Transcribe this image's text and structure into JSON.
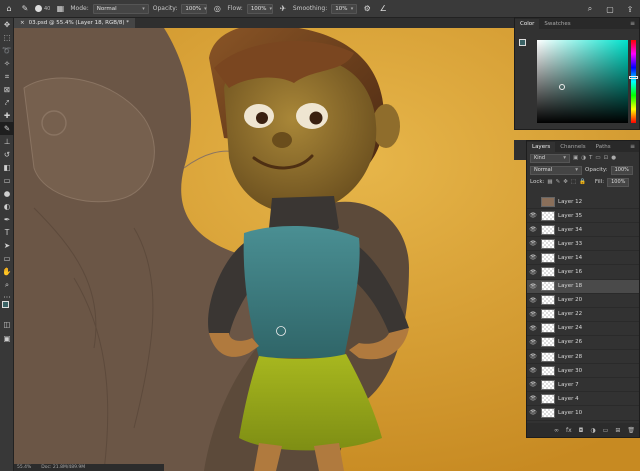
{
  "options_bar": {
    "brush_size": "40",
    "mode_label": "Mode:",
    "mode_value": "Normal",
    "opacity_label": "Opacity:",
    "opacity_value": "100%",
    "flow_label": "Flow:",
    "flow_value": "100%",
    "smoothing_label": "Smoothing:",
    "smoothing_value": "10%"
  },
  "document_tab": {
    "title": "03.psd @ 55.4% (Layer 18, RGB/8) *",
    "close": "×"
  },
  "color_panel": {
    "tabs": [
      "Color",
      "Swatches"
    ],
    "foreground": "#3b6366",
    "background": "#eeeeee",
    "hue": "#00e2cc"
  },
  "layers_panel": {
    "tabs": [
      "Layers",
      "Channels",
      "Paths"
    ],
    "kind_label": "Kind",
    "blend_mode": "Normal",
    "opacity_label": "Opacity:",
    "opacity_value": "100%",
    "lock_label": "Lock:",
    "fill_label": "Fill:",
    "fill_value": "100%",
    "layers": [
      {
        "name": "Layer 12",
        "visible": false,
        "thumb": "pic"
      },
      {
        "name": "Layer 35",
        "visible": true,
        "thumb": "blank"
      },
      {
        "name": "Layer 34",
        "visible": true,
        "thumb": "blank"
      },
      {
        "name": "Layer 33",
        "visible": true,
        "thumb": "blank"
      },
      {
        "name": "Layer 14",
        "visible": true,
        "thumb": "blank"
      },
      {
        "name": "Layer 16",
        "visible": true,
        "thumb": "blank"
      },
      {
        "name": "Layer 18",
        "visible": true,
        "thumb": "blank",
        "selected": true
      },
      {
        "name": "Layer 20",
        "visible": true,
        "thumb": "blank"
      },
      {
        "name": "Layer 22",
        "visible": true,
        "thumb": "blank"
      },
      {
        "name": "Layer 24",
        "visible": true,
        "thumb": "blank"
      },
      {
        "name": "Layer 26",
        "visible": true,
        "thumb": "blank"
      },
      {
        "name": "Layer 28",
        "visible": true,
        "thumb": "blank"
      },
      {
        "name": "Layer 30",
        "visible": true,
        "thumb": "blank"
      },
      {
        "name": "Layer 7",
        "visible": true,
        "thumb": "blank"
      },
      {
        "name": "Layer 4",
        "visible": true,
        "thumb": "blank"
      },
      {
        "name": "Layer 10",
        "visible": true,
        "thumb": "blank"
      }
    ]
  },
  "status": {
    "zoom": "55.4%",
    "doc": "Doc: 21.8M/489.9M"
  },
  "icons": {
    "eye": "👁",
    "menu": "≡"
  },
  "colors": {
    "canvas_bg": "#d9a23a",
    "hair": "#6b3d1c",
    "skin": "#8a6a2e",
    "top": "#3c7b7e",
    "skirt": "#9eb020",
    "sleeve": "#3a3633",
    "sketch": "#6b5646"
  }
}
